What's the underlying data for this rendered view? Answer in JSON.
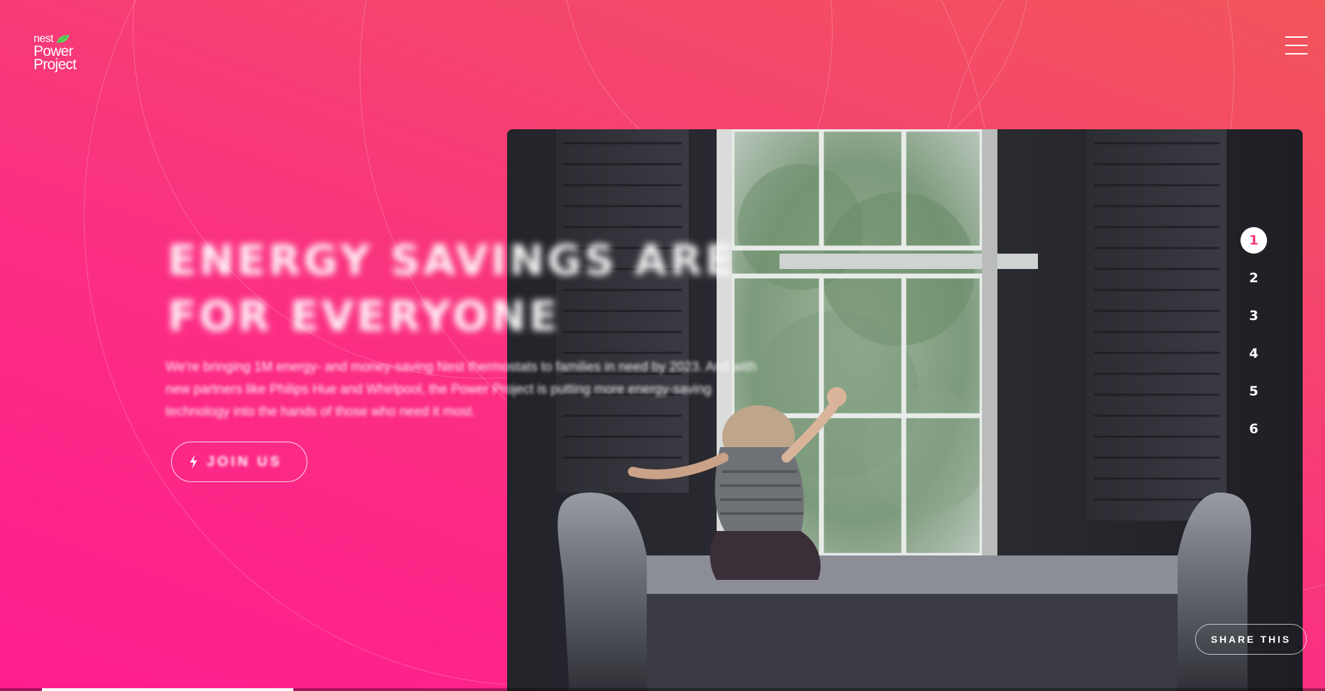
{
  "brand": {
    "nest": "nest",
    "power": "Power",
    "project": "Project",
    "leaf_color": "#5fd35a"
  },
  "hero": {
    "headline_line1": "ENERGY SAVINGS ARE",
    "headline_line2": "FOR EVERYONE",
    "subtext": "We're bringing 1M energy- and money-saving Nest thermostats to families in need by 2023. And with new partners like Philips Hue and Whirlpool, the Power Project is putting more energy-saving technology into the hands of those who need it most.",
    "cta_label": "JOIN US",
    "cta_icon": "lightning-bolt-icon"
  },
  "nav": {
    "menu_icon": "hamburger-menu-icon"
  },
  "pager": {
    "items": [
      "1",
      "2",
      "3",
      "4",
      "5",
      "6"
    ],
    "active_index": 0
  },
  "share": {
    "label": "SHARE THIS"
  },
  "progress": {
    "fraction": 0.19
  },
  "colors": {
    "gradient_top": "#f2555a",
    "gradient_bottom": "#ff1d8e",
    "active_number": "#f33a72"
  }
}
